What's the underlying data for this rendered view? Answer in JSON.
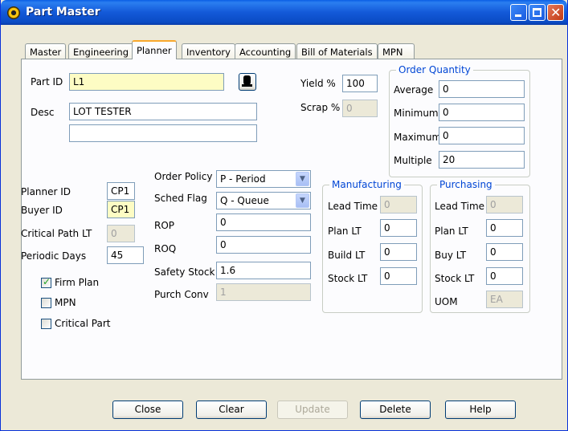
{
  "window": {
    "title": "Part Master"
  },
  "tabs": [
    "Master",
    "Engineering",
    "Planner",
    "Inventory",
    "Accounting",
    "Bill of Materials",
    "MPN"
  ],
  "active_tab": "Planner",
  "part": {
    "id_label": "Part ID",
    "id_value": "L1",
    "desc_label": "Desc",
    "desc_value": "LOT TESTER",
    "desc2_value": ""
  },
  "yield": {
    "label": "Yield %",
    "value": "100"
  },
  "scrap": {
    "label": "Scrap %",
    "value": "0"
  },
  "order_quantity": {
    "title": "Order Quantity",
    "average_label": "Average",
    "average": "0",
    "minimum_label": "Minimum",
    "minimum": "0",
    "maximum_label": "Maximum",
    "maximum": "0",
    "multiple_label": "Multiple",
    "multiple": "20"
  },
  "planner": {
    "label": "Planner ID",
    "value": "CP1"
  },
  "buyer": {
    "label": "Buyer ID",
    "value": "CP1"
  },
  "critical_path": {
    "label": "Critical Path LT",
    "value": "0"
  },
  "periodic_days": {
    "label": "Periodic Days",
    "value": "45"
  },
  "checks": {
    "firm_plan": "Firm Plan",
    "firm_plan_checked": true,
    "mpn": "MPN",
    "mpn_checked": false,
    "critical_part": "Critical Part",
    "critical_part_checked": false
  },
  "order_policy": {
    "label": "Order Policy",
    "value": "P - Period"
  },
  "sched_flag": {
    "label": "Sched Flag",
    "value": "Q - Queue"
  },
  "rop": {
    "label": "ROP",
    "value": "0"
  },
  "roq": {
    "label": "ROQ",
    "value": "0"
  },
  "safety_stock": {
    "label": "Safety Stock",
    "value": "1.6"
  },
  "purch_conv": {
    "label": "Purch Conv",
    "value": "1"
  },
  "manufacturing": {
    "title": "Manufacturing",
    "lead_time_label": "Lead Time",
    "lead_time": "0",
    "plan_lt_label": "Plan LT",
    "plan_lt": "0",
    "build_lt_label": "Build LT",
    "build_lt": "0",
    "stock_lt_label": "Stock LT",
    "stock_lt": "0"
  },
  "purchasing": {
    "title": "Purchasing",
    "lead_time_label": "Lead Time",
    "lead_time": "0",
    "plan_lt_label": "Plan LT",
    "plan_lt": "0",
    "buy_lt_label": "Buy LT",
    "buy_lt": "0",
    "stock_lt_label": "Stock LT",
    "stock_lt": "0",
    "uom_label": "UOM",
    "uom": "EA"
  },
  "buttons": {
    "close": "Close",
    "clear": "Clear",
    "update": "Update",
    "delete": "Delete",
    "help": "Help"
  },
  "colors": {
    "titlebar": "#0a5ee4",
    "group_title": "#0046d5",
    "face": "#ece9d8"
  }
}
